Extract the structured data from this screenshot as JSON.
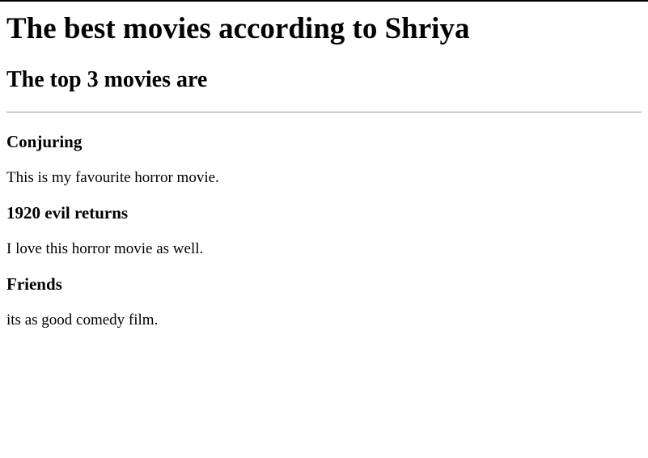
{
  "page": {
    "title": "The best movies according to Shriya",
    "subtitle": "The top 3 movies are"
  },
  "movies": [
    {
      "name": "Conjuring",
      "description": "This is my favourite horror movie."
    },
    {
      "name": "1920 evil returns",
      "description": "I love this horror movie as well."
    },
    {
      "name": "Friends",
      "description": "its as good comedy film."
    }
  ]
}
